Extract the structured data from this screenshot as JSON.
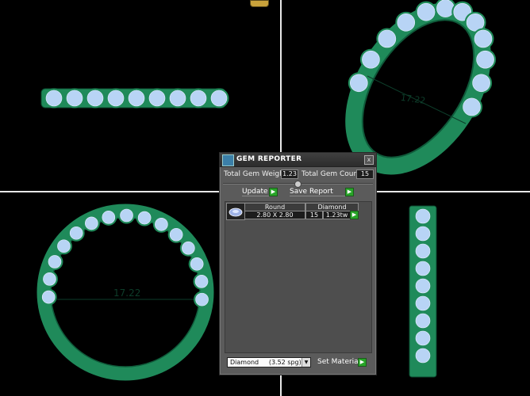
{
  "viewport": {
    "dimension_front": "17.22",
    "dimension_perspective": "17.22"
  },
  "colors": {
    "metal": "#1f8a5a",
    "metal_dark": "#0f5a3a",
    "gem": "#b8d4f5",
    "background": "#000000",
    "divider": "#e8e8e8",
    "go_button": "#28a428"
  },
  "panel": {
    "title": "GEM REPORTER",
    "close_label": "x",
    "total_gem_weight_label": "Total Gem Weight",
    "total_gem_weight_value": "1.23",
    "total_gem_count_label": "Total Gem Count",
    "total_gem_count_value": "15",
    "update_label": "Update",
    "save_report_label": "Save Report",
    "go_icon": "play-arrow-icon",
    "table": {
      "shape": "Round",
      "size": "2.80 X 2.80",
      "material": "Diamond",
      "count": "15",
      "weight": "1.23tw"
    },
    "material_select_value": "Diamond     (3.52 spg)",
    "set_material_label": "Set Material"
  }
}
